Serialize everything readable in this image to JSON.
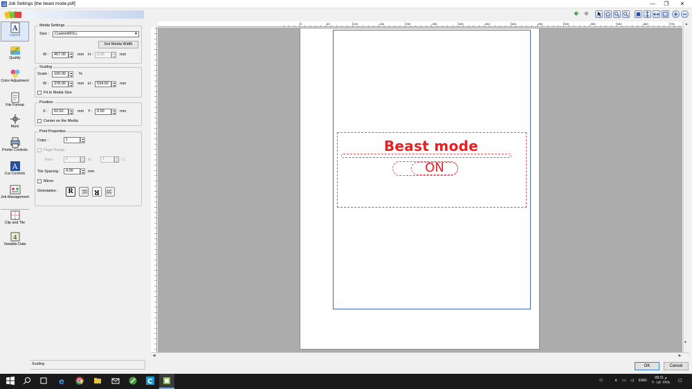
{
  "window": {
    "title": "Job Settings [the beast mode.pdf]",
    "min": "—",
    "max": "❐",
    "close": "✕"
  },
  "sidebar": {
    "items": [
      {
        "label": "Layout",
        "icon": "layout-icon"
      },
      {
        "label": "Quality",
        "icon": "quality-icon"
      },
      {
        "label": "Color Adjustment",
        "icon": "color-adjustment-icon"
      },
      {
        "label": "File Format",
        "icon": "file-format-icon"
      },
      {
        "label": "Mark",
        "icon": "mark-icon"
      },
      {
        "label": "Printer Controls",
        "icon": "printer-controls-icon"
      },
      {
        "label": "Cut Controls",
        "icon": "cut-controls-icon"
      },
      {
        "label": "Job Management",
        "icon": "job-management-icon"
      },
      {
        "label": "Clip and Tile",
        "icon": "clip-and-tile-icon"
      },
      {
        "label": "Variable Data",
        "icon": "variable-data-icon"
      }
    ]
  },
  "media": {
    "group": "Media Settings",
    "size_label": "Size :",
    "size_value": "CustomROLL",
    "get_width": "Get Media Width",
    "w_label": "W :",
    "w_value": "457.00",
    "w_unit": "mm",
    "h_label": "H :",
    "h_value": "0.00",
    "h_unit": "mm"
  },
  "scaling": {
    "group": "Scaling",
    "scale_label": "Scale :",
    "scale_value": "100.00",
    "scale_unit": "%",
    "w_label": "W :",
    "w_value": "378.00",
    "w_unit": "mm",
    "h_label": "H :",
    "h_value": "534.60",
    "h_unit": "mm",
    "fit": "Fit to Media Size"
  },
  "position": {
    "group": "Position",
    "x_label": "X :",
    "x_value": "62.62",
    "x_unit": "mm",
    "y_label": "Y :",
    "y_value": "0.00",
    "y_unit": "mm",
    "center": "Center on the Media"
  },
  "print": {
    "group": "Print Properties",
    "copy_label": "Copy :",
    "copy_value": "1",
    "page_range": "Page Range",
    "from_label": "from :",
    "from_value": "1",
    "to_label": "to :",
    "to_value": "1",
    "of_text": "/ 1",
    "tile_label": "Tile Spacing :",
    "tile_value": "4.00",
    "tile_unit": "mm",
    "mirror": "Mirror",
    "orientation_label": "Orientation :"
  },
  "status": {
    "text": "Scaling"
  },
  "ruler": {
    "labels": [
      "0",
      "50",
      "100",
      "150",
      "200",
      "250",
      "300",
      "350",
      "400",
      "450",
      "500",
      "550",
      "600",
      "650",
      "700"
    ]
  },
  "design": {
    "title": "Beast mode",
    "switch": "ON"
  },
  "buttons": {
    "ok": "OK",
    "cancel": "Cancel"
  },
  "taskbar": {
    "time": "09:11 م",
    "date": "٢٠١٨/٠٢/٢٨",
    "lang": "ENG"
  }
}
